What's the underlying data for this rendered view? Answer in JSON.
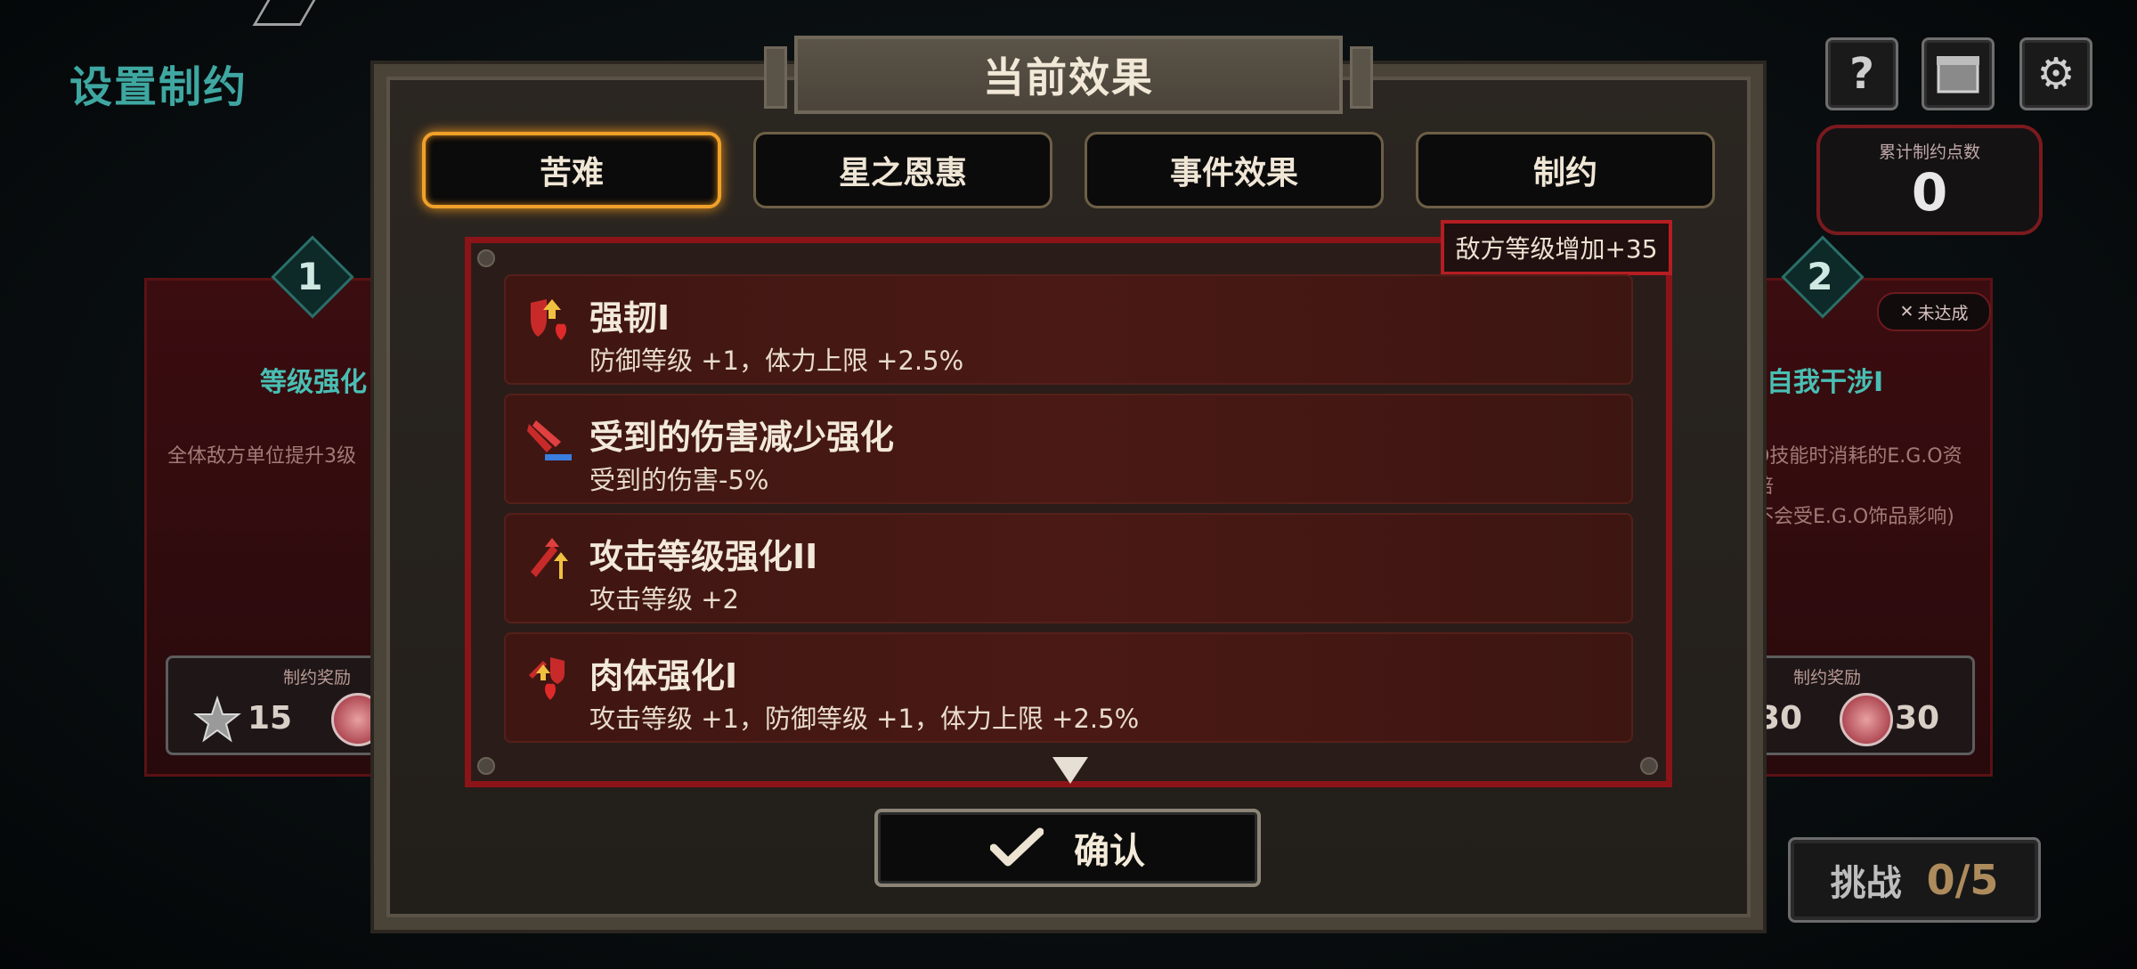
{
  "page": {
    "title": "设置制约"
  },
  "counter": {
    "label": "累计制约点数",
    "value": "0"
  },
  "left_card": {
    "number": "1",
    "name": "等级强化",
    "desc": "全体敌方单位提升3级",
    "reward_label": "制约奖励",
    "reward_a": "15"
  },
  "right_card": {
    "number": "2",
    "status": "未达成",
    "name": "自我干涉I",
    "desc_lines": [
      "O技能时消耗的E.G.O资",
      "倍",
      "不会受E.G.O饰品影响)"
    ],
    "reward_label": "制约奖励",
    "reward_a": "30",
    "reward_b": "30"
  },
  "challenge": {
    "label": "挑战",
    "count": "0/5"
  },
  "dialog": {
    "title": "当前效果",
    "tabs": [
      "苦难",
      "星之恩惠",
      "事件效果",
      "制约"
    ],
    "active_tab": 0,
    "enemy_level": "敌方等级增加+35",
    "confirm_label": "确认",
    "effects": [
      {
        "title": "强韧I",
        "desc": "防御等级 +1，体力上限 +2.5%",
        "icon": "shield-heart-up-icon"
      },
      {
        "title": "受到的伤害减少强化",
        "desc": "受到的伤害-5%",
        "icon": "damage-reduce-icon"
      },
      {
        "title": "攻击等级强化II",
        "desc": "攻击等级 +2",
        "icon": "attack-up-icon"
      },
      {
        "title": "肉体强化I",
        "desc": "攻击等级 +1，防御等级 +1，体力上限 +2.5%",
        "icon": "body-up-icon"
      }
    ]
  },
  "colors": {
    "accent": "#f0a12a",
    "frame_red": "#8c1418",
    "teal": "#3fa7a1"
  }
}
